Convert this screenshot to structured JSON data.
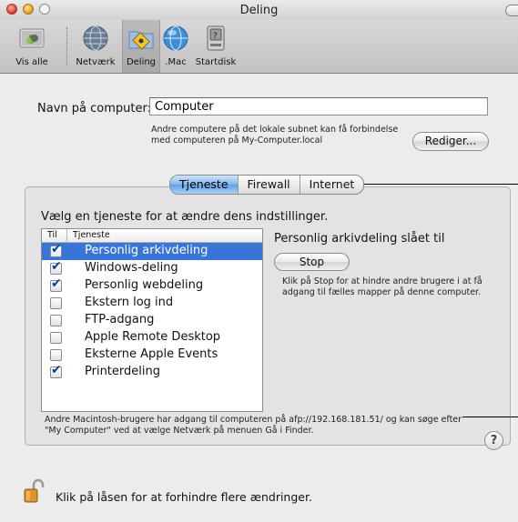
{
  "window": {
    "title": "Deling"
  },
  "toolbar": {
    "items": [
      {
        "label": "Vis alle",
        "icon": "show-all-icon"
      },
      {
        "label": "Netværk",
        "icon": "network-globe-icon"
      },
      {
        "label": "Deling",
        "icon": "sharing-folder-icon",
        "selected": true
      },
      {
        "label": ".Mac",
        "icon": "dotmac-icon"
      },
      {
        "label": "Startdisk",
        "icon": "startup-disk-icon"
      }
    ]
  },
  "computer_name": {
    "label": "Navn på computer:",
    "value": "Computer",
    "description": "Andre computere på det lokale subnet kan få forbindelse med computeren på My-Computer.local",
    "edit_button": "Rediger..."
  },
  "tabs": [
    {
      "label": "Tjeneste",
      "active": true
    },
    {
      "label": "Firewall",
      "active": false
    },
    {
      "label": "Internet",
      "active": false
    }
  ],
  "services": {
    "prompt": "Vælg en tjeneste for at ændre dens indstillinger.",
    "col_on": "Til",
    "col_service": "Tjeneste",
    "rows": [
      {
        "name": "Personlig arkivdeling",
        "checked": true,
        "selected": true
      },
      {
        "name": "Windows-deling",
        "checked": true,
        "selected": false
      },
      {
        "name": "Personlig webdeling",
        "checked": true,
        "selected": false
      },
      {
        "name": "Ekstern log ind",
        "checked": false,
        "selected": false
      },
      {
        "name": "FTP-adgang",
        "checked": false,
        "selected": false
      },
      {
        "name": "Apple Remote Desktop",
        "checked": false,
        "selected": false
      },
      {
        "name": "Eksterne Apple Events",
        "checked": false,
        "selected": false
      },
      {
        "name": "Printerdeling",
        "checked": true,
        "selected": false
      }
    ]
  },
  "status": {
    "title": "Personlig arkivdeling slået til",
    "button": "Stop",
    "description": "Klik på Stop for at hindre andre brugere i at få adgang til fælles mapper på denne computer."
  },
  "info": "Andre Macintosh-brugere har adgang til computeren på afp://192.168.181.51/ og kan søge efter \"My Computer\" ved at vælge Netværk på menuen Gå i Finder.",
  "help_label": "?",
  "lock_text": "Klik på låsen for at forhindre flere ændringer.",
  "colors": {
    "selection": "#3875d7",
    "tab_active": "#7fb6ea"
  }
}
